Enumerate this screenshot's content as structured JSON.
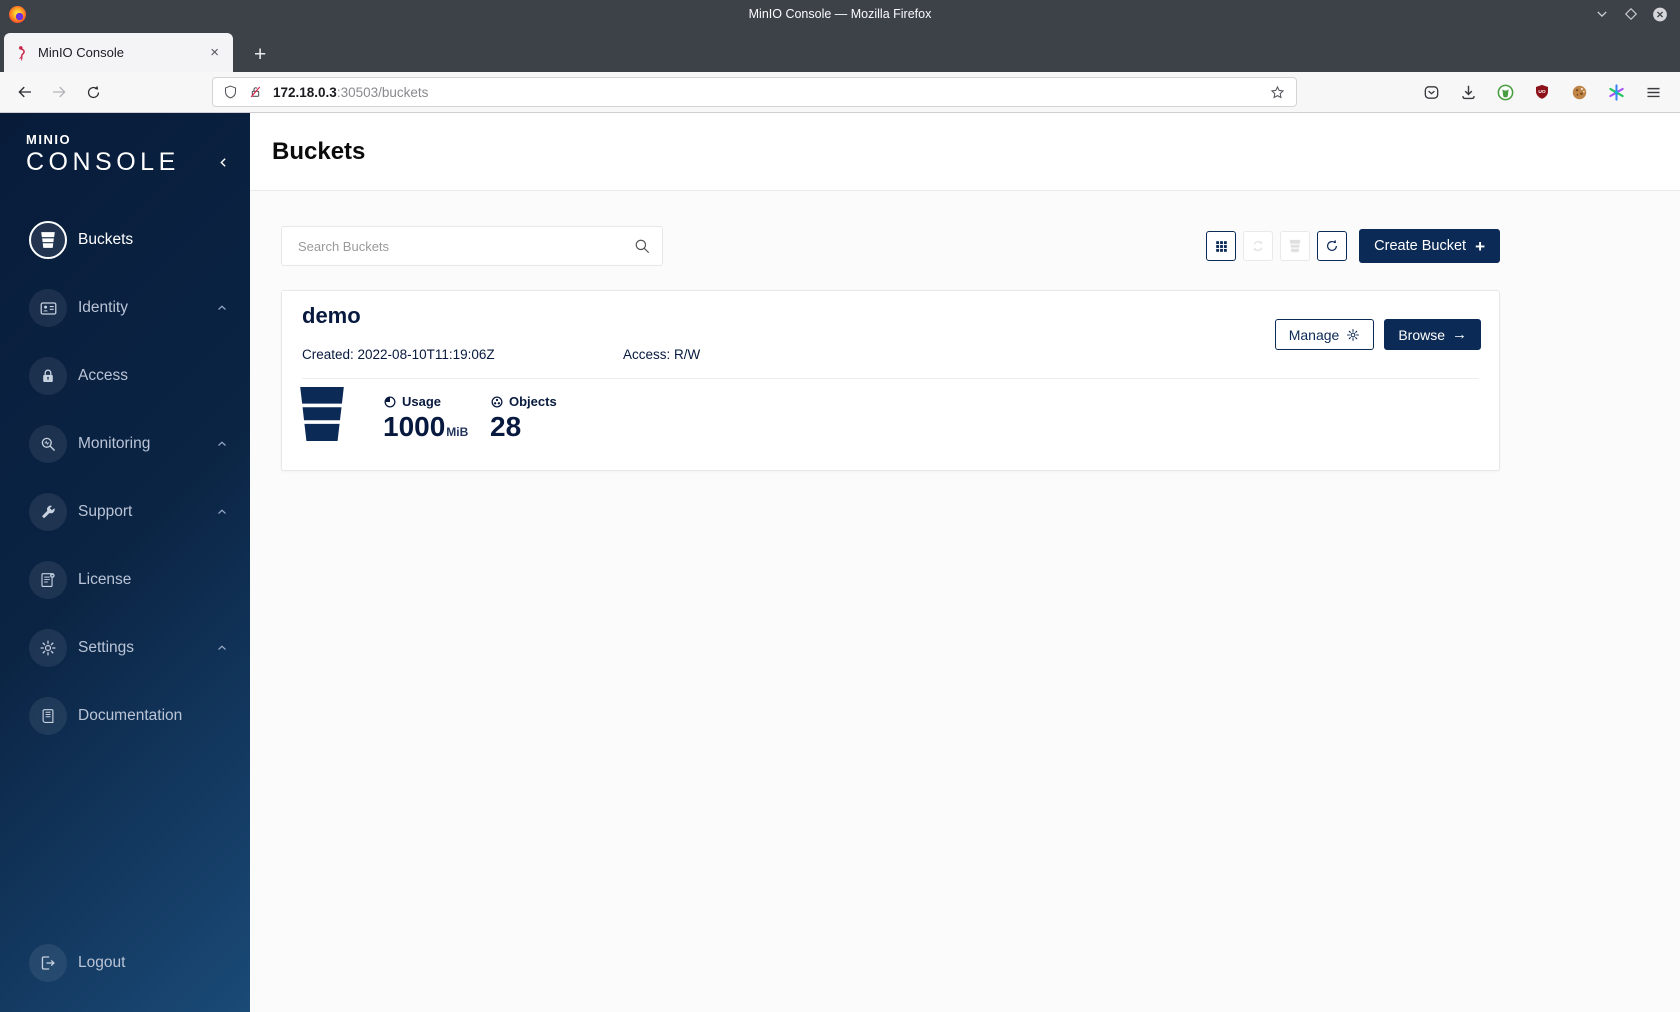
{
  "window": {
    "title": "MinIO Console — Mozilla Firefox"
  },
  "browser": {
    "tab_title": "MinIO Console",
    "close_tab_glyph": "×",
    "new_tab_glyph": "+",
    "url_host": "172.18.0.3",
    "url_rest": ":30503/buckets"
  },
  "sidebar": {
    "logo_line1": "MINIO",
    "logo_line2": "CONSOLE",
    "items": [
      {
        "label": "Buckets",
        "icon": "bucket-icon",
        "selected": true
      },
      {
        "label": "Identity",
        "icon": "identity-card-icon",
        "expandable": true
      },
      {
        "label": "Access",
        "icon": "lock-icon"
      },
      {
        "label": "Monitoring",
        "icon": "magnifier-icon",
        "expandable": true
      },
      {
        "label": "Support",
        "icon": "wrench-icon",
        "expandable": true
      },
      {
        "label": "License",
        "icon": "license-doc-icon"
      },
      {
        "label": "Settings",
        "icon": "gear-icon",
        "expandable": true
      },
      {
        "label": "Documentation",
        "icon": "book-icon"
      }
    ],
    "logout_label": "Logout"
  },
  "page": {
    "title": "Buckets"
  },
  "toolbar": {
    "search_placeholder": "Search Buckets",
    "create_button_label": "Create Bucket",
    "create_button_plus": "+"
  },
  "bucket": {
    "name": "demo",
    "created": "Created: 2022-08-10T11:19:06Z",
    "access": "Access: R/W",
    "usage_label": "Usage",
    "usage_value": "1000",
    "usage_unit": "MiB",
    "objects_label": "Objects",
    "objects_value": "28",
    "manage_label": "Manage",
    "browse_label": "Browse",
    "browse_arrow": "→"
  },
  "colors": {
    "navy_text": "#07193E",
    "button_navy": "#0C2A56",
    "sidebar_gradient_start": "#081C3A",
    "sidebar_gradient_end": "#1A4A77",
    "content_bg": "#FBFBFB",
    "disabled_border": "#E9E9E9",
    "titlebar_bg": "#3D4249"
  }
}
